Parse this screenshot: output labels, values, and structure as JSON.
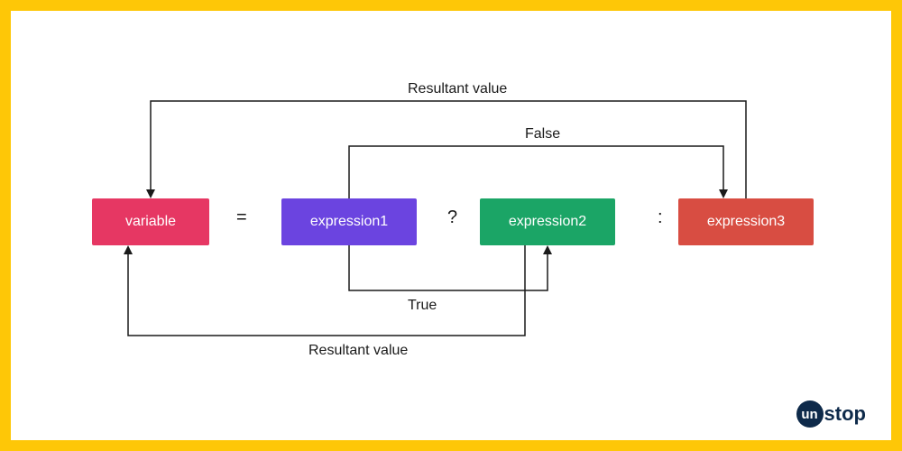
{
  "nodes": {
    "variable": "variable",
    "expr1": "expression1",
    "expr2": "expression2",
    "expr3": "expression3"
  },
  "operators": {
    "eq": "=",
    "qmark": "?",
    "colon": ":"
  },
  "labels": {
    "resultant_top": "Resultant value",
    "false": "False",
    "true": "True",
    "resultant_bottom": "Resultant value"
  },
  "logo": {
    "prefix": "un",
    "suffix": "stop"
  }
}
